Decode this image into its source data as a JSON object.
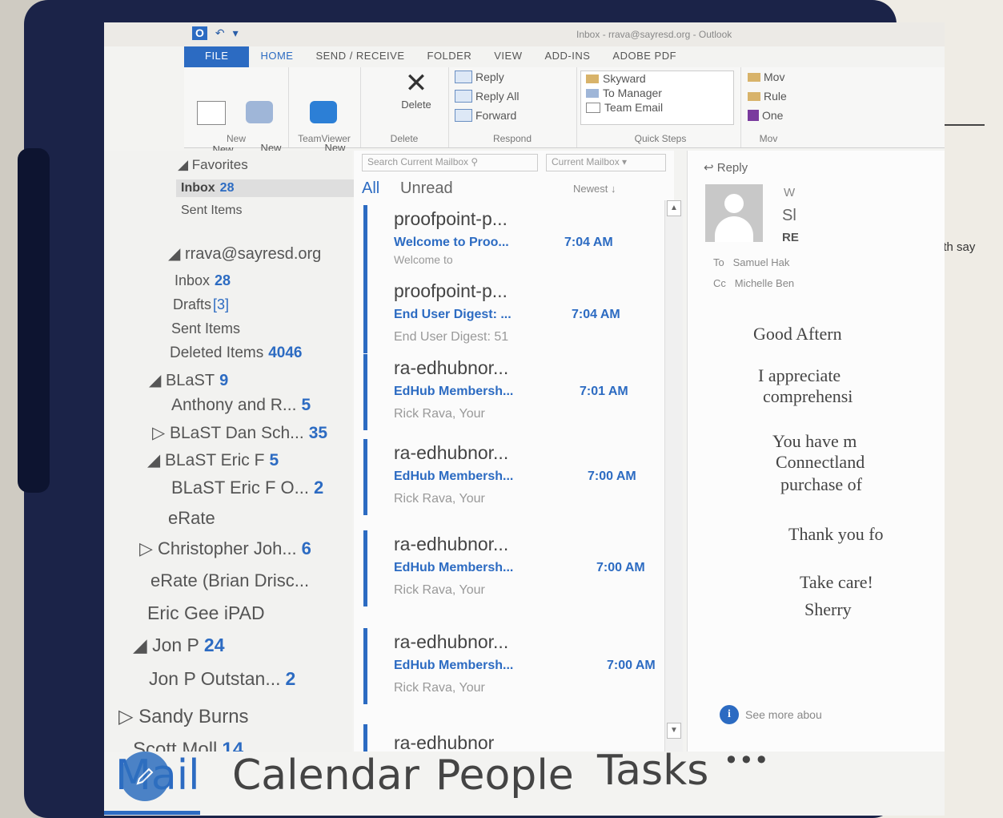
{
  "surroundings": {
    "paper_text": "y both say"
  },
  "window": {
    "title": "Inbox - rrava@sayresd.org - Outlook",
    "quick_access": [
      "O",
      "↶",
      "▾"
    ]
  },
  "ribbon": {
    "tabs": [
      "FILE",
      "HOME",
      "SEND / RECEIVE",
      "FOLDER",
      "VIEW",
      "ADD-INS",
      "ADOBE PDF"
    ],
    "new_email": "New\nEmail",
    "new_items": "New\nItems",
    "new_group": "New",
    "new_meeting": "New\nMeeting",
    "teamviewer_group": "TeamViewer",
    "delete": "Delete",
    "delete_group": "Delete",
    "reply": "Reply",
    "reply_all": "Reply All",
    "forward": "Forward",
    "respond_group": "Respond",
    "quick_steps": [
      "Skyward",
      "To Manager",
      "Team Email"
    ],
    "quick_steps_group": "Quick Steps",
    "move_items": [
      "Mov",
      "Rule",
      "One"
    ],
    "move_group": "Mov"
  },
  "folders": {
    "favorites_label": "Favorites",
    "fav_inbox": "Inbox",
    "fav_inbox_count": "28",
    "fav_sent": "Sent Items",
    "account": "rrava@sayresd.org",
    "items": [
      {
        "label": "Inbox",
        "count": "28"
      },
      {
        "label": "Drafts",
        "count": "[3]"
      },
      {
        "label": "Sent Items",
        "count": ""
      },
      {
        "label": "Deleted Items",
        "count": "4046"
      },
      {
        "label": "◢ BLaST",
        "count": "9"
      },
      {
        "label": "Anthony and R...",
        "count": "5"
      },
      {
        "label": "▷ BLaST Dan Sch...",
        "count": "35"
      },
      {
        "label": "◢ BLaST Eric F",
        "count": "5"
      },
      {
        "label": "BLaST Eric F O...",
        "count": "2"
      },
      {
        "label": "eRate",
        "count": ""
      },
      {
        "label": "▷ Christopher Joh...",
        "count": "6"
      },
      {
        "label": "eRate (Brian Drisc...",
        "count": ""
      },
      {
        "label": "Eric Gee iPAD",
        "count": ""
      },
      {
        "label": "◢ Jon P",
        "count": "24"
      },
      {
        "label": "Jon P Outstan...",
        "count": "2"
      },
      {
        "label": "▷ Sandy Burns",
        "count": ""
      },
      {
        "label": "Scott Moll",
        "count": "14"
      }
    ]
  },
  "list": {
    "search_placeholder": "Search Current Mailbox",
    "scope": "Current Mailbox",
    "filter_all": "All",
    "filter_unread": "Unread",
    "sort": "Newest ↓",
    "messages": [
      {
        "from": "proofpoint-p...",
        "subject": "Welcome to Proo...",
        "time": "7:04 AM",
        "preview": "Welcome to"
      },
      {
        "from": "proofpoint-p...",
        "subject": "End User Digest: ...",
        "time": "7:04 AM",
        "preview": "End User Digest: 51"
      },
      {
        "from": "ra-edhubnor...",
        "subject": "EdHub Membersh...",
        "time": "7:01 AM",
        "preview": "Rick Rava, Your"
      },
      {
        "from": "ra-edhubnor...",
        "subject": "EdHub Membersh...",
        "time": "7:00 AM",
        "preview": "Rick Rava, Your"
      },
      {
        "from": "ra-edhubnor...",
        "subject": "EdHub Membersh...",
        "time": "7:00 AM",
        "preview": "Rick Rava, Your"
      },
      {
        "from": "ra-edhubnor...",
        "subject": "EdHub Membersh...",
        "time": "7:00 AM",
        "preview": "Rick Rava, Your"
      },
      {
        "from": "ra-edhubnor",
        "subject": "",
        "time": "",
        "preview": ""
      }
    ]
  },
  "reading": {
    "reply": "Reply",
    "sender_line1": "W",
    "sender_line2": "Sl",
    "sender_line3": "RE",
    "to_label": "To",
    "to_value": "Samuel Hak",
    "cc_label": "Cc",
    "cc_value": "Michelle Ben",
    "body": [
      "Good Aftern",
      "I appreciate",
      "comprehensi",
      "You have m",
      "Connectland",
      "purchase of",
      "Thank you fo",
      "Take care!",
      "Sherry"
    ],
    "see_more": "See more abou"
  },
  "nav": {
    "mail": "Mail",
    "calendar": "Calendar",
    "people": "People",
    "tasks": "Tasks",
    "more": "•••"
  },
  "colors": {
    "accent": "#2c6bc2",
    "bezel": "#1b2348"
  }
}
